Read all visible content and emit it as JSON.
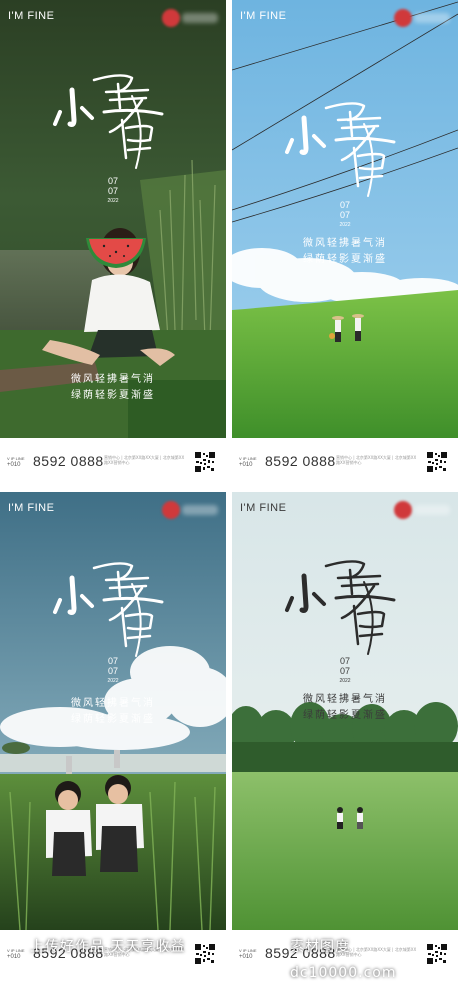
{
  "posters": [
    {
      "brand": "I'M FINE",
      "date_month": "07",
      "date_day": "07",
      "year": "2022",
      "poem_line1": "微风轻拂暑气消",
      "poem_line2": "绿荫轻影夏渐盛",
      "phone_prefix_1": "V IP LINE",
      "phone_prefix_2": "+010",
      "phone": "8592 0888",
      "address": "营销中心 | 北京第XX路XX大厦 | 北京城第XX路XX营销中心"
    },
    {
      "brand": "I'M FINE",
      "date_month": "07",
      "date_day": "07",
      "year": "2022",
      "poem_line1": "微风轻拂暑气消",
      "poem_line2": "绿荫轻影夏渐盛",
      "phone_prefix_1": "V IP LINE",
      "phone_prefix_2": "+010",
      "phone": "8592 0888",
      "address": "营销中心 | 北京第XX路XX大厦 | 北京城第XX路XX营销中心"
    },
    {
      "brand": "I'M FINE",
      "date_month": "07",
      "date_day": "07",
      "year": "2022",
      "poem_line1": "微风轻拂暑气消",
      "poem_line2": "绿荫轻影夏渐盛",
      "phone_prefix_1": "V IP LINE",
      "phone_prefix_2": "+010",
      "phone": "8592 0888",
      "address": "营销中心 | 北京第XX路XX大厦 | 北京城第XX路XX营销中心"
    },
    {
      "brand": "I'M FINE",
      "date_month": "07",
      "date_day": "07",
      "year": "2022",
      "poem_line1": "微风轻拂暑气消",
      "poem_line2": "绿荫轻影夏渐盛",
      "phone_prefix_1": "V IP LINE",
      "phone_prefix_2": "+010",
      "phone": "8592 0888",
      "address": "营销中心 | 北京第XX路XX大厦 | 北京城第XX路XX营销中心"
    }
  ],
  "calligraphy_text": "小暑",
  "watermark_left": "上传好作品 天天享收益",
  "watermark_right": "素材图度 dc10000.com",
  "colors": {
    "poster1_bg": "#2f4a2a",
    "poster2_sky": "#74b9e3",
    "poster3_sky": "#4f7b90",
    "poster4_sky": "#dfe9ea",
    "grass": "#5ea632",
    "logo_red": "#d0393b"
  }
}
